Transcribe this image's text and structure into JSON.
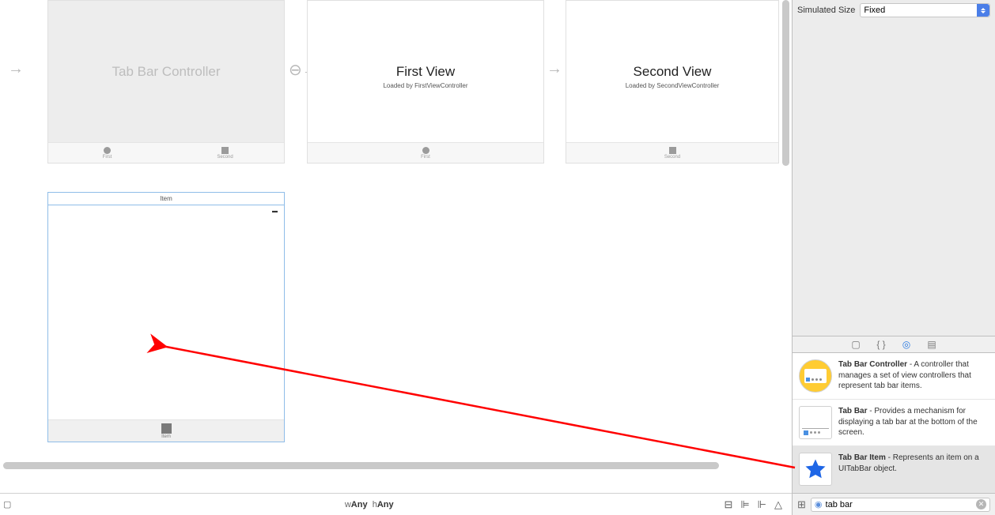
{
  "canvas": {
    "scenes": {
      "tabBarController": {
        "title": "Tab Bar Controller",
        "tabs": [
          {
            "label": "First",
            "iconType": "circle"
          },
          {
            "label": "Second",
            "iconType": "square"
          }
        ]
      },
      "firstView": {
        "title": "First View",
        "subtitle": "Loaded by FirstViewController",
        "tabs": [
          {
            "label": "First",
            "iconType": "circle"
          }
        ]
      },
      "secondView": {
        "title": "Second View",
        "subtitle": "Loaded by SecondViewController",
        "tabs": [
          {
            "label": "Second",
            "iconType": "square"
          }
        ]
      },
      "itemScene": {
        "header": "Item",
        "tabs": [
          {
            "label": "Item",
            "iconType": "square"
          }
        ]
      }
    },
    "sizeClass": {
      "wPrefix": "w",
      "wValue": "Any",
      "hPrefix": "h",
      "hValue": "Any"
    }
  },
  "inspector": {
    "simulatedSize": {
      "label": "Simulated Size",
      "value": "Fixed"
    }
  },
  "library": {
    "items": [
      {
        "name": "Tab Bar Controller",
        "desc": " - A controller that manages a set of view controllers that represent tab bar items."
      },
      {
        "name": "Tab Bar",
        "desc": " - Provides a mechanism for displaying a tab bar at the bottom of the screen."
      },
      {
        "name": "Tab Bar Item",
        "desc": " - Represents an item on a UITabBar object."
      }
    ],
    "searchValue": "tab bar"
  }
}
